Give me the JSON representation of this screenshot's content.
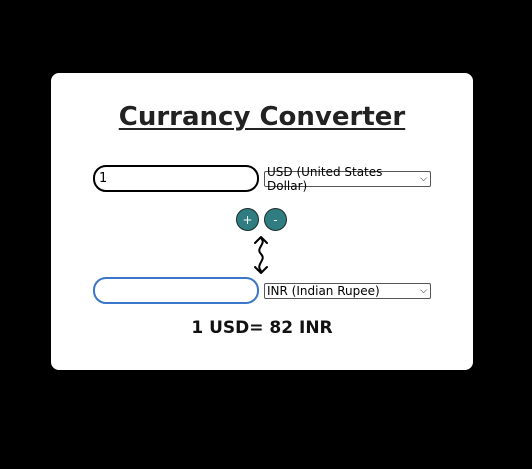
{
  "title": "Currancy Converter",
  "from": {
    "amount": "1",
    "currency": "USD (United States Dollar)"
  },
  "to": {
    "amount": "",
    "currency": "INR (Indian Rupee)"
  },
  "buttons": {
    "plus": "+",
    "minus": "-"
  },
  "icons": {
    "swap": "swap-arrows-icon",
    "dropdown": "chevron-down-icon"
  },
  "result": "1 USD= 82 INR",
  "colors": {
    "background": "#000000",
    "card": "#ffffff",
    "button": "#2f7d80",
    "focus_border": "#3a76c9"
  }
}
